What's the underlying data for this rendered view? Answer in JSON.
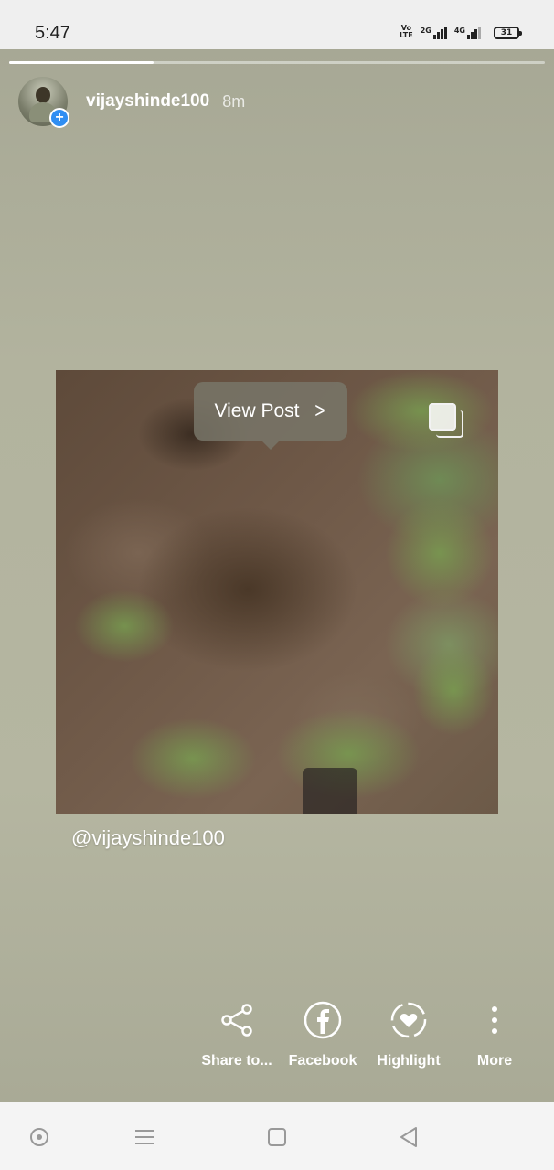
{
  "status_bar": {
    "time": "5:47",
    "volte_top": "Vo",
    "volte_bottom": "LTE",
    "net1": "2G",
    "net2": "4G",
    "battery": "31"
  },
  "story": {
    "progress": 0.27,
    "username": "vijayshinde100",
    "time_ago": "8m",
    "view_post_label": "View Post",
    "mention": "@vijayshinde100",
    "actions": [
      {
        "label": "Share to...",
        "icon": "share-icon"
      },
      {
        "label": "Facebook",
        "icon": "facebook-icon"
      },
      {
        "label": "Highlight",
        "icon": "highlight-icon"
      },
      {
        "label": "More",
        "icon": "more-icon"
      }
    ]
  },
  "nav_bar": {
    "icons": [
      "assistant-icon",
      "menu-icon",
      "home-square-icon",
      "back-triangle-icon"
    ]
  },
  "colors": {
    "story_background": "#b2b39e",
    "badge_blue": "#2f8ef2"
  }
}
